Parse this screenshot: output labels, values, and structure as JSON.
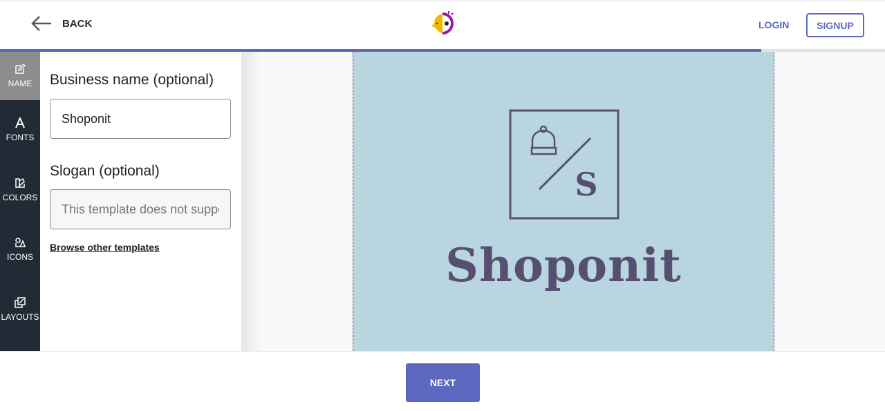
{
  "header": {
    "back_label": "BACK",
    "login_label": "LOGIN",
    "signup_label": "SIGNUP"
  },
  "progress": {
    "percent": 86,
    "color": "#5c67c0"
  },
  "sidebar": {
    "items": [
      {
        "label": "NAME",
        "icon": "edit-icon",
        "active": true
      },
      {
        "label": "FONTS",
        "icon": "font-icon"
      },
      {
        "label": "COLORS",
        "icon": "palette-icon"
      },
      {
        "label": "ICONS",
        "icon": "shapes-icon"
      },
      {
        "label": "LAYOUTS",
        "icon": "layout-icon"
      }
    ]
  },
  "panel": {
    "business_label": "Business name (optional)",
    "business_value": "Shoponit",
    "slogan_label": "Slogan (optional)",
    "slogan_placeholder": "This template does not support slogans",
    "browse_link": "Browse other templates"
  },
  "preview": {
    "brand_name": "Shoponit",
    "monogram": "S",
    "background": "#b8d5e0",
    "ink": "#574f72"
  },
  "footer": {
    "next_label": "NEXT"
  }
}
